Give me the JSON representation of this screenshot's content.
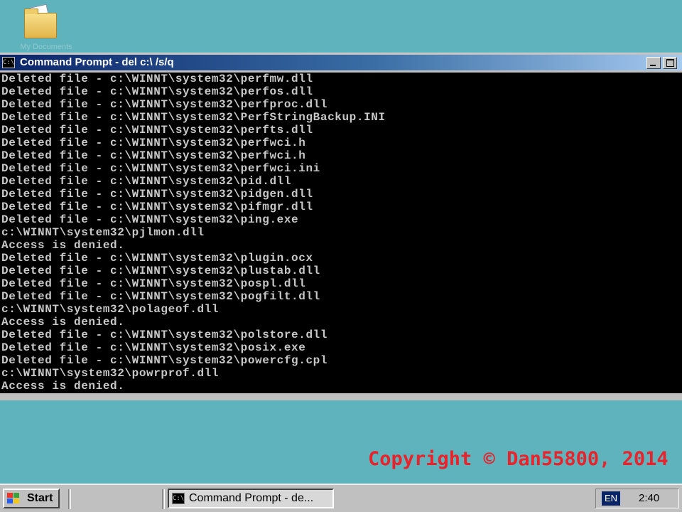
{
  "desktop": {
    "icon_label": "My Documents"
  },
  "window": {
    "title": "Command Prompt - del c:\\ /s/q",
    "icon_glyph": "C:\\"
  },
  "console": {
    "lines": [
      "Deleted file - c:\\WINNT\\system32\\perfmw.dll",
      "Deleted file - c:\\WINNT\\system32\\perfos.dll",
      "Deleted file - c:\\WINNT\\system32\\perfproc.dll",
      "Deleted file - c:\\WINNT\\system32\\PerfStringBackup.INI",
      "Deleted file - c:\\WINNT\\system32\\perfts.dll",
      "Deleted file - c:\\WINNT\\system32\\perfwci.h",
      "Deleted file - c:\\WINNT\\system32\\perfwci.h",
      "Deleted file - c:\\WINNT\\system32\\perfwci.ini",
      "Deleted file - c:\\WINNT\\system32\\pid.dll",
      "Deleted file - c:\\WINNT\\system32\\pidgen.dll",
      "Deleted file - c:\\WINNT\\system32\\pifmgr.dll",
      "Deleted file - c:\\WINNT\\system32\\ping.exe",
      "c:\\WINNT\\system32\\pjlmon.dll",
      "Access is denied.",
      "Deleted file - c:\\WINNT\\system32\\plugin.ocx",
      "Deleted file - c:\\WINNT\\system32\\plustab.dll",
      "Deleted file - c:\\WINNT\\system32\\pospl.dll",
      "Deleted file - c:\\WINNT\\system32\\pogfilt.dll",
      "c:\\WINNT\\system32\\polageof.dll",
      "Access is denied.",
      "Deleted file - c:\\WINNT\\system32\\polstore.dll",
      "Deleted file - c:\\WINNT\\system32\\posix.exe",
      "Deleted file - c:\\WINNT\\system32\\powercfg.cpl",
      "c:\\WINNT\\system32\\powrprof.dll",
      "Access is denied."
    ]
  },
  "watermark": {
    "text": "Copyright © Dan55800, 2014"
  },
  "taskbar": {
    "start_label": "Start",
    "task_label": "Command Prompt - de...",
    "lang": "EN",
    "clock": "2:40"
  }
}
